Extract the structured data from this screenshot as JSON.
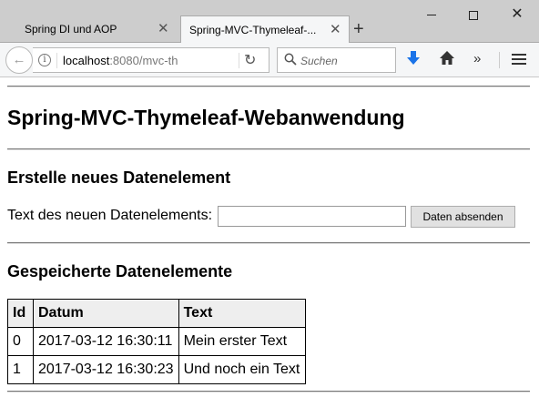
{
  "browser": {
    "tabs": [
      {
        "label": "Spring DI und AOP",
        "active": false
      },
      {
        "label": "Spring-MVC-Thymeleaf-...",
        "active": true
      }
    ],
    "url_host": "localhost",
    "url_rest": ":8080/mvc-th",
    "search_placeholder": "Suchen",
    "icons": {
      "back": "back-arrow-icon",
      "info": "info-icon",
      "reload": "reload-icon",
      "search": "search-icon",
      "download": "download-icon",
      "home": "home-icon",
      "overflow": "overflow-chevron-icon",
      "menu": "hamburger-menu-icon"
    },
    "accent_color": "#1a73e8"
  },
  "page": {
    "title": "Spring-MVC-Thymeleaf-Webanwendung",
    "create_section": {
      "heading": "Erstelle neues Datenelement",
      "input_label": "Text des neuen Datenelements:",
      "input_value": "",
      "submit_label": "Daten absenden"
    },
    "stored_section": {
      "heading": "Gespeicherte Datenelemente",
      "columns": [
        "Id",
        "Datum",
        "Text"
      ],
      "rows": [
        [
          "0",
          "2017-03-12 16:30:11",
          "Mein erster Text"
        ],
        [
          "1",
          "2017-03-12 16:30:23",
          "Und noch ein Text"
        ]
      ]
    }
  }
}
